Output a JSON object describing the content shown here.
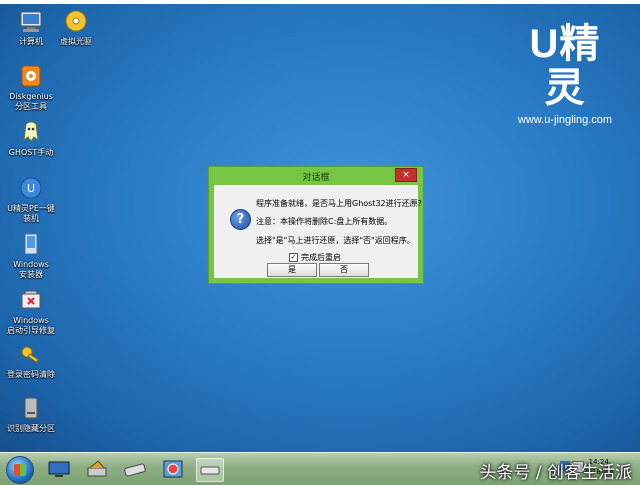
{
  "desktop": {
    "icons": [
      {
        "label": "计算机",
        "icon": "computer-icon"
      },
      {
        "label": "虚拟光驱",
        "icon": "virtual-drive-icon"
      },
      {
        "label": "Diskgenius\n分区工具",
        "icon": "diskgenius-icon"
      },
      {
        "label": "GHOST手动",
        "icon": "ghost-icon"
      },
      {
        "label": "U精灵PE一键\n装机",
        "icon": "install-icon"
      },
      {
        "label": "Windows\n安装器",
        "icon": "windows-installer-icon"
      },
      {
        "label": "Windows\n启动引导修复",
        "icon": "boot-repair-icon"
      },
      {
        "label": "登录密码清除",
        "icon": "key-icon"
      },
      {
        "label": "识别隐藏分区",
        "icon": "disk-icon"
      }
    ]
  },
  "logo": {
    "brand": "U精灵",
    "url": "www.u-jingling.com"
  },
  "dialog": {
    "title": "对话框",
    "close": "×",
    "line1": "程序准备就绪，是否马上用Ghost32进行还原?",
    "line2": "注意：本操作将删除C:盘上所有数据。",
    "line3": "选择\"是\"马上进行还原，选择\"否\"返回程序。",
    "checkbox_label": "完成后重启",
    "checkbox_mark": "✓",
    "yes": "是",
    "no": "否",
    "question_mark": "?"
  },
  "taskbar": {
    "clock": "14:24",
    "date": "2018/4/4"
  },
  "watermark": "头条号 / 创客生活派",
  "colors": {
    "dialog_frame": "#77c545",
    "desktop": "#2a7cc5",
    "close": "#c7302a"
  }
}
